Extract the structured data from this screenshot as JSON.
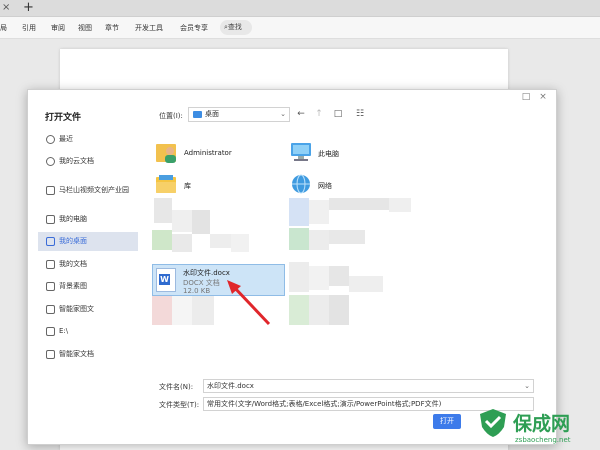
{
  "tabbar": {
    "close_glyph": "×",
    "new_glyph": "+"
  },
  "ribbon": {
    "items": [
      "局",
      "引用",
      "审阅",
      "视图",
      "章节",
      "开发工具",
      "会员专享"
    ],
    "search_label": "查找"
  },
  "dialog": {
    "title": "打开文件",
    "window_buttons": [
      "□",
      "×"
    ],
    "sidebar": [
      {
        "label": "最近",
        "icon": "clock-icon"
      },
      {
        "label": "我的云文档",
        "icon": "cloud-icon"
      },
      {
        "label": "马栏山视频文创产业园",
        "icon": "building-icon"
      },
      {
        "label": "我的电脑",
        "icon": "computer-icon"
      },
      {
        "label": "我的桌面",
        "icon": "desktop-icon",
        "active": true
      },
      {
        "label": "我的文档",
        "icon": "document-icon"
      },
      {
        "label": "背景素图",
        "icon": "image-icon"
      },
      {
        "label": "智能家图文",
        "icon": "folder-icon"
      },
      {
        "label": "E:\\",
        "icon": "drive-icon"
      },
      {
        "label": "智能家文档",
        "icon": "folder-icon"
      }
    ],
    "location_label": "位置(I):",
    "location_value": "桌面",
    "nav": {
      "back": "←",
      "up": "↑",
      "new_folder": "□",
      "view": "☷"
    },
    "items": [
      {
        "name": "Administrator",
        "icon": "user-folder-icon"
      },
      {
        "name": "此电脑",
        "icon": "computer-icon"
      },
      {
        "name": "库",
        "icon": "library-folder-icon"
      },
      {
        "name": "网络",
        "icon": "network-icon"
      }
    ],
    "selected_file": {
      "name": "水印文件.docx",
      "type": "DOCX 文档",
      "size": "12.0 KB",
      "icon_letter": "W"
    },
    "filename_label": "文件名(N):",
    "filename_value": "水印文件.docx",
    "filetype_label": "文件类型(T):",
    "filetype_value": "常用文件(文字/Word格式;表格/Excel格式;演示/PowerPoint格式;PDF文件)",
    "open_button": "打开"
  },
  "watermark": {
    "brand": "保成网",
    "url": "zsbaocheng.net"
  },
  "colors": {
    "accent": "#3d7bea",
    "selection": "#cde4f7",
    "arrow": "#e0262b",
    "brand_green": "#2e9e54"
  }
}
